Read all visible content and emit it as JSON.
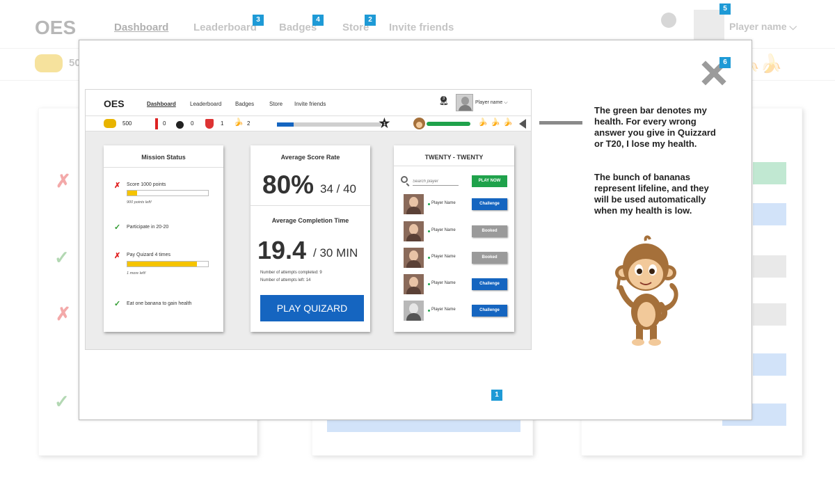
{
  "background": {
    "logo": "OES",
    "nav": [
      "Dashboard",
      "Leaderboard",
      "Badges",
      "Store",
      "Invite friends"
    ],
    "player_name": "Player name",
    "coins": "50"
  },
  "badges": {
    "leaderboard": "3",
    "badges": "4",
    "store": "2",
    "player": "5",
    "close": "6",
    "bottom": "1"
  },
  "mini": {
    "logo": "OES",
    "nav": [
      "Dashboard",
      "Leaderboard",
      "Badges",
      "Store",
      "Invite friends"
    ],
    "notification_count": "3",
    "player_name": "Player name",
    "stats": {
      "coins": "500",
      "dynamite": "0",
      "bomb": "0",
      "shield": "1",
      "banana": "2"
    },
    "level_star": "1",
    "level_progress": 0.16,
    "mission_status": {
      "title": "Mission Status",
      "items": [
        {
          "status": "fail",
          "text": "Score 1000 points",
          "progress": 0.12,
          "note": "900 points left!"
        },
        {
          "status": "done",
          "text": "Participate in 20-20"
        },
        {
          "status": "fail",
          "text": "Pay Quizard 4 times",
          "progress": 0.86,
          "note": "1 more left!"
        },
        {
          "status": "done",
          "text": "Eat one banana to gain health"
        }
      ]
    },
    "score": {
      "title": "Average Score Rate",
      "percent": "80%",
      "fraction": "34 / 40",
      "completion_title": "Average Completion Time",
      "time": "19.4",
      "time_total": "/ 30 MIN",
      "attempts_completed": "Number of attempts completed:  9",
      "attempts_left": "Number of attempts left: 14",
      "play_button": "PLAY QUIZARD"
    },
    "twenty": {
      "title": "TWENTY - TWENTY",
      "search_placeholder": "Search player",
      "play_now": "PLAY NOW",
      "players": [
        {
          "name": "Player Name",
          "action": "Challenge"
        },
        {
          "name": "Player Name",
          "action": "Booked"
        },
        {
          "name": "Player Name",
          "action": "Booked"
        },
        {
          "name": "Player Name",
          "action": "Challenge"
        },
        {
          "name": "Player Name",
          "action": "Challenge"
        }
      ]
    }
  },
  "explanation": {
    "health": "The green bar denotes my health. For every wrong answer you give in Quizzard or T20, I lose my health.",
    "bananas": "The bunch of bananas represent lifeline, and they will be used automatically when my health is low."
  },
  "colors": {
    "badge": "#1e9ad6",
    "primary_blue": "#1565c0",
    "health_green": "#1fa24b",
    "progress_yellow": "#f5c400"
  }
}
